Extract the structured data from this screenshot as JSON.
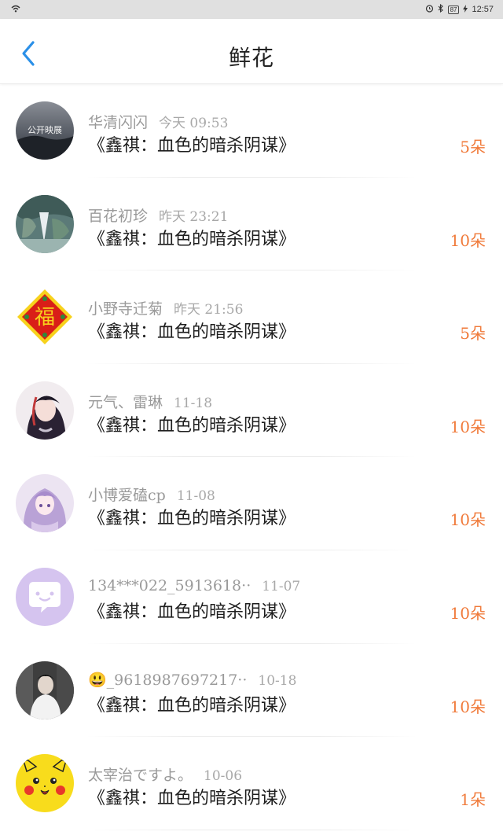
{
  "status_bar": {
    "battery": "87",
    "time": "12:57"
  },
  "header": {
    "title": "鲜花"
  },
  "items": [
    {
      "name": "华清闪闪",
      "time": "今天 09:53",
      "book": "《鑫祺：血色的暗杀阴谋》",
      "count": "5朵",
      "avatar_text": "公开映展"
    },
    {
      "name": "百花初珍",
      "time": "昨天 23:21",
      "book": "《鑫祺：血色的暗杀阴谋》",
      "count": "10朵"
    },
    {
      "name": "小野寺迁菊",
      "time": "昨天 21:56",
      "book": "《鑫祺：血色的暗杀阴谋》",
      "count": "5朵",
      "avatar_text": "福"
    },
    {
      "name": "元气、雷琳",
      "time": "11-18",
      "book": "《鑫祺：血色的暗杀阴谋》",
      "count": "10朵"
    },
    {
      "name": "小博爱磕cp",
      "time": "11-08",
      "book": "《鑫祺：血色的暗杀阴谋》",
      "count": "10朵"
    },
    {
      "name": "134***022_5913618··",
      "time": "11-07",
      "book": "《鑫祺：血色的暗杀阴谋》",
      "count": "10朵"
    },
    {
      "name": "😃_9618987697217··",
      "time": "10-18",
      "book": "《鑫祺：血色的暗杀阴谋》",
      "count": "10朵"
    },
    {
      "name": "太宰治ですよ。",
      "time": "10-06",
      "book": "《鑫祺：血色的暗杀阴谋》",
      "count": "1朵"
    }
  ],
  "colors": {
    "accent": "#2b90e8",
    "count": "#f07a3a"
  }
}
